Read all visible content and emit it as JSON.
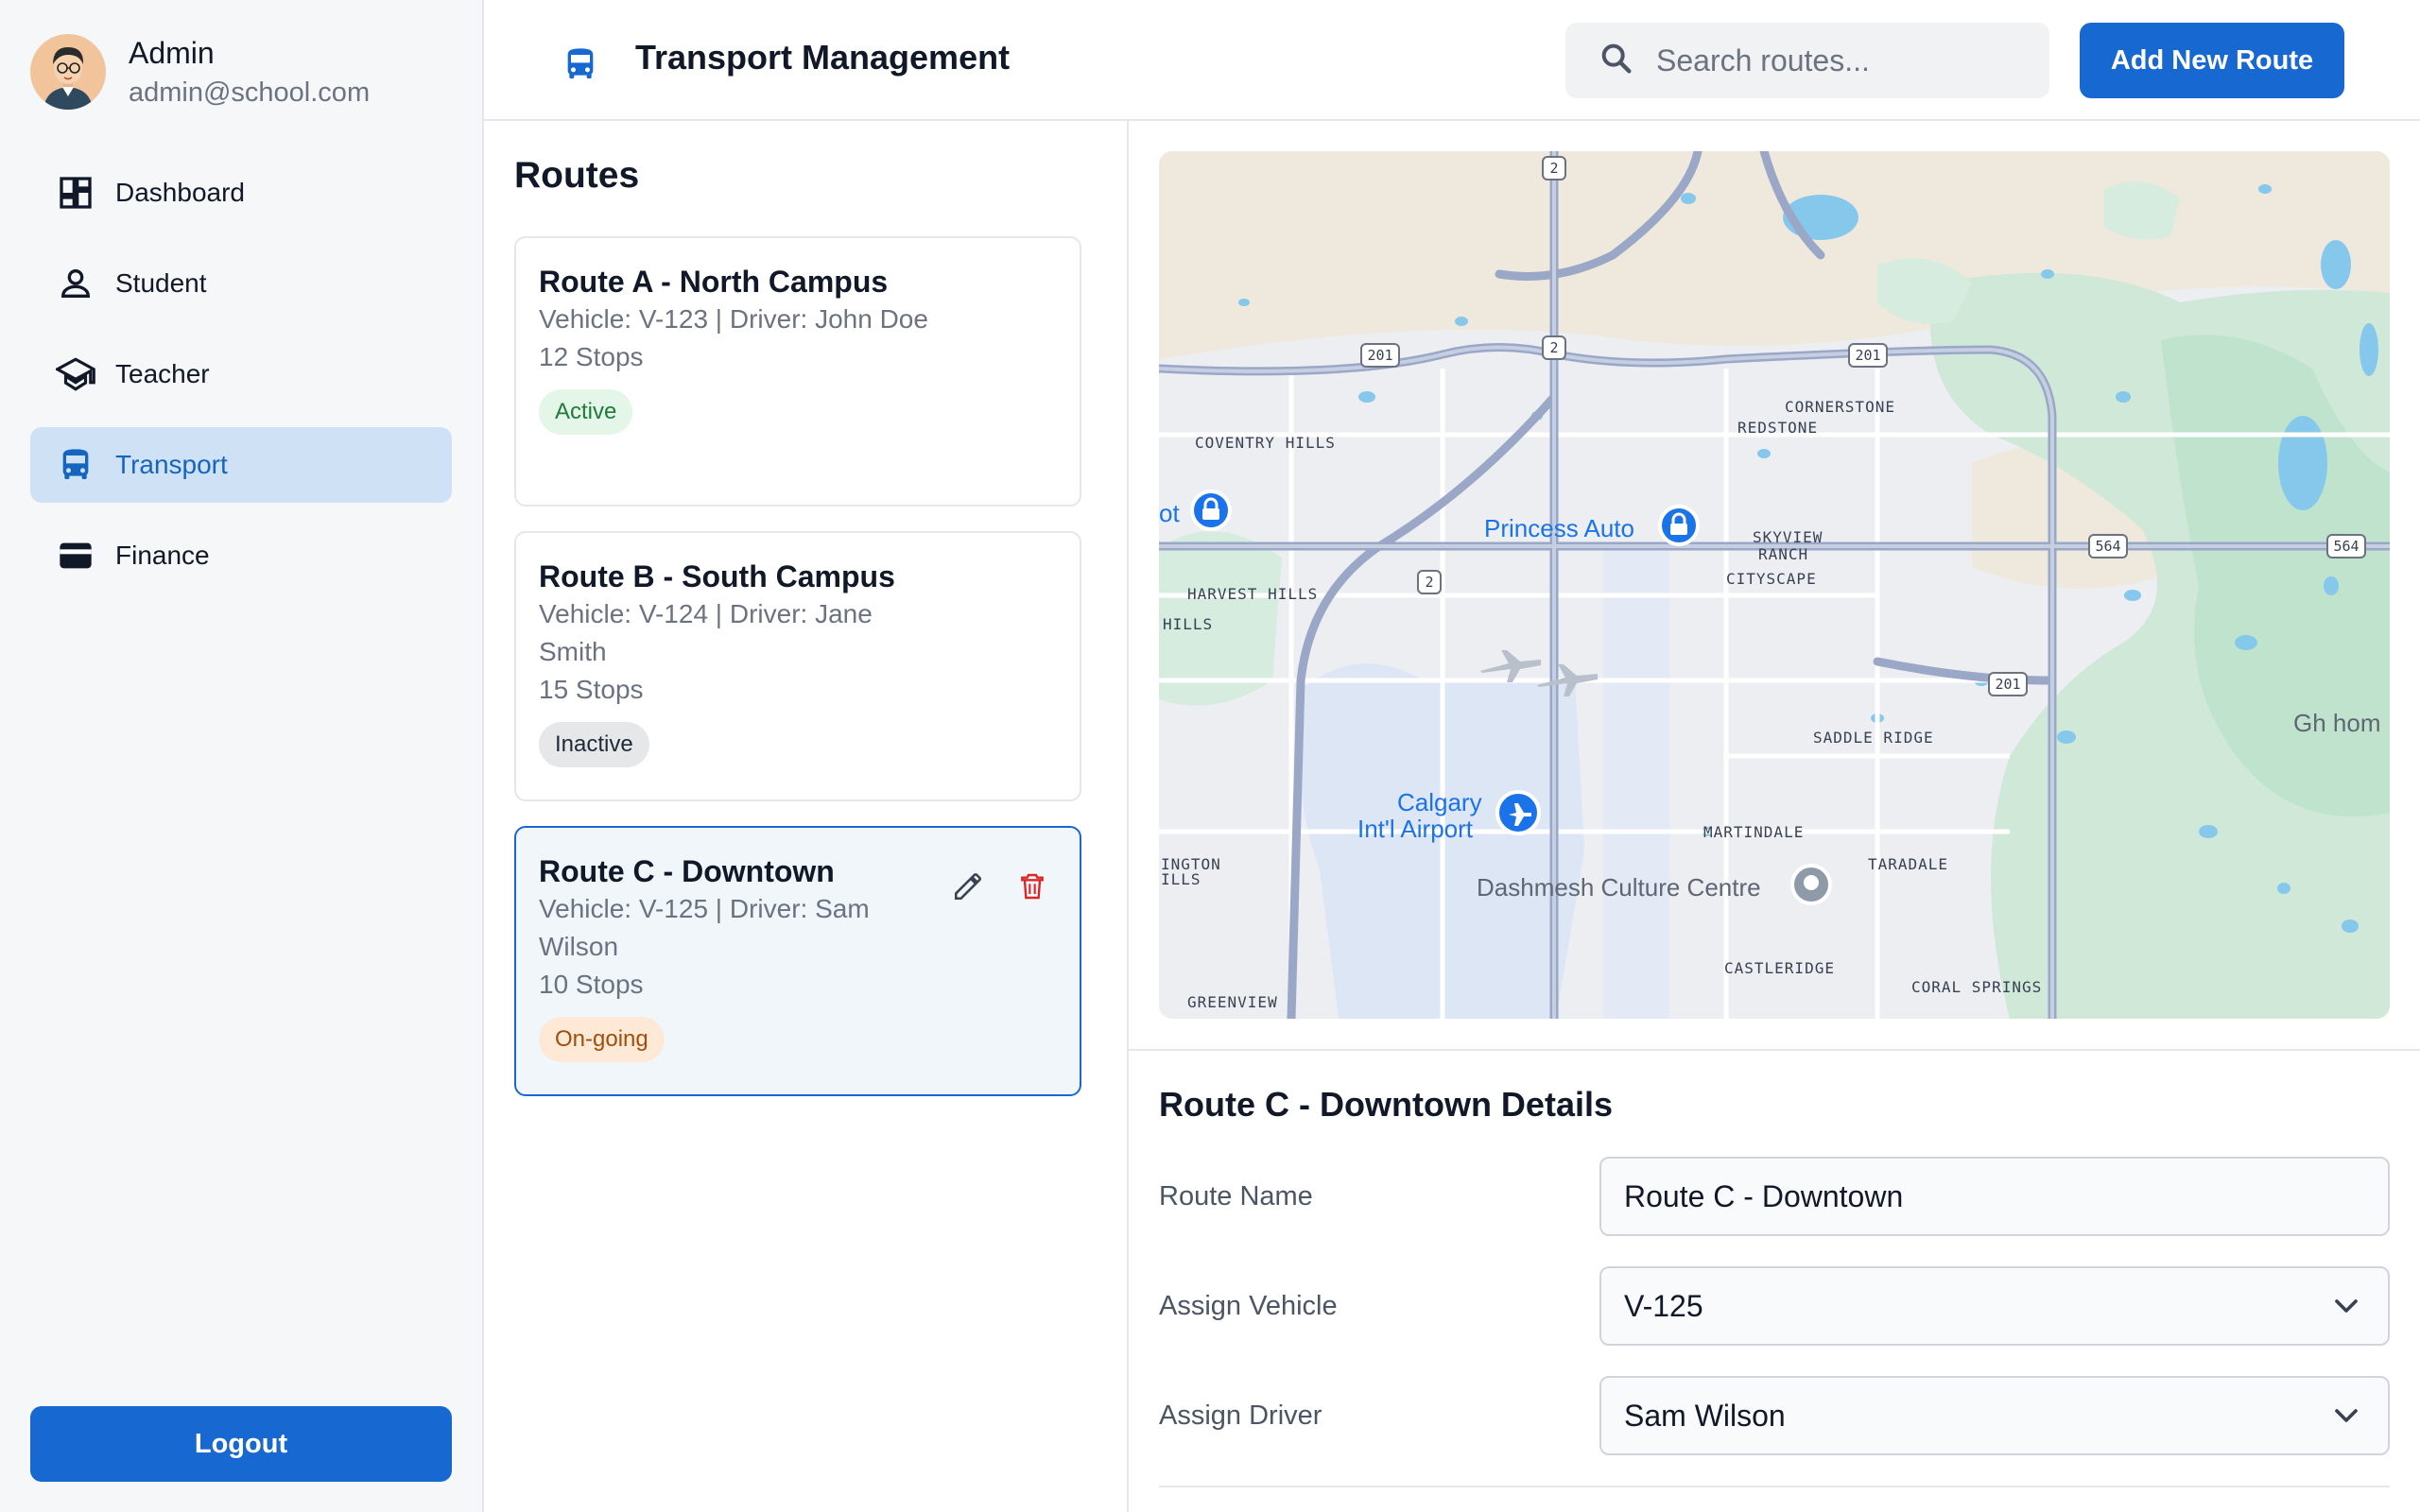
{
  "user": {
    "name": "Admin",
    "email": "admin@school.com"
  },
  "nav": [
    {
      "label": "Dashboard",
      "icon": "dashboard-icon",
      "active": false
    },
    {
      "label": "Student",
      "icon": "person-icon",
      "active": false
    },
    {
      "label": "Teacher",
      "icon": "graduation-cap-icon",
      "active": false
    },
    {
      "label": "Transport",
      "icon": "bus-icon",
      "active": true
    },
    {
      "label": "Finance",
      "icon": "wallet-icon",
      "active": false
    }
  ],
  "logout_label": "Logout",
  "header": {
    "title": "Transport Management",
    "search_placeholder": "Search routes...",
    "add_button": "Add New Route"
  },
  "routes": {
    "title": "Routes",
    "items": [
      {
        "name": "Route A - North Campus",
        "meta": "Vehicle: V-123 | Driver: John Doe",
        "stops": "12 Stops",
        "status": "Active"
      },
      {
        "name": "Route B - South Campus",
        "meta": "Vehicle: V-124 | Driver: Jane Smith",
        "stops": "15 Stops",
        "status": "Inactive"
      },
      {
        "name": "Route C - Downtown",
        "meta": "Vehicle: V-125 | Driver: Sam Wilson",
        "stops": "10 Stops",
        "status": "On-going"
      }
    ]
  },
  "map": {
    "labels": {
      "coventry": "COVENTRY HILLS",
      "cornerstone": "CORNERSTONE",
      "redstone": "REDSTONE",
      "skyview1": "SKYVIEW",
      "skyview2": "RANCH",
      "cityscape": "CITYSCAPE",
      "harvest": "HARVEST HILLS",
      "hills": "HILLS",
      "saddle": "SADDLE RIDGE",
      "martindale": "MARTINDALE",
      "taradale": "TARADALE",
      "castleridge": "CASTLERIDGE",
      "coral": "CORAL SPRINGS",
      "greenview": "GREENVIEW",
      "ington1": "INGTON",
      "ington2": "ILLS",
      "princess": "Princess Auto",
      "airport1": "Calgary",
      "airport2": "Int'l Airport",
      "dashmesh": "Dashmesh Culture Centre",
      "ot": "ot",
      "ghhom": "Gh hom",
      "shield_201": "201",
      "shield_2": "2",
      "shield_564": "564"
    }
  },
  "details": {
    "title": "Route C - Downtown Details",
    "route_name_label": "Route Name",
    "route_name_value": "Route C - Downtown",
    "vehicle_label": "Assign Vehicle",
    "vehicle_value": "V-125",
    "driver_label": "Assign Driver",
    "driver_value": "Sam Wilson"
  },
  "colors": {
    "primary": "#1769d1",
    "active_nav_bg": "#cfe1f5",
    "danger": "#dc2626"
  }
}
